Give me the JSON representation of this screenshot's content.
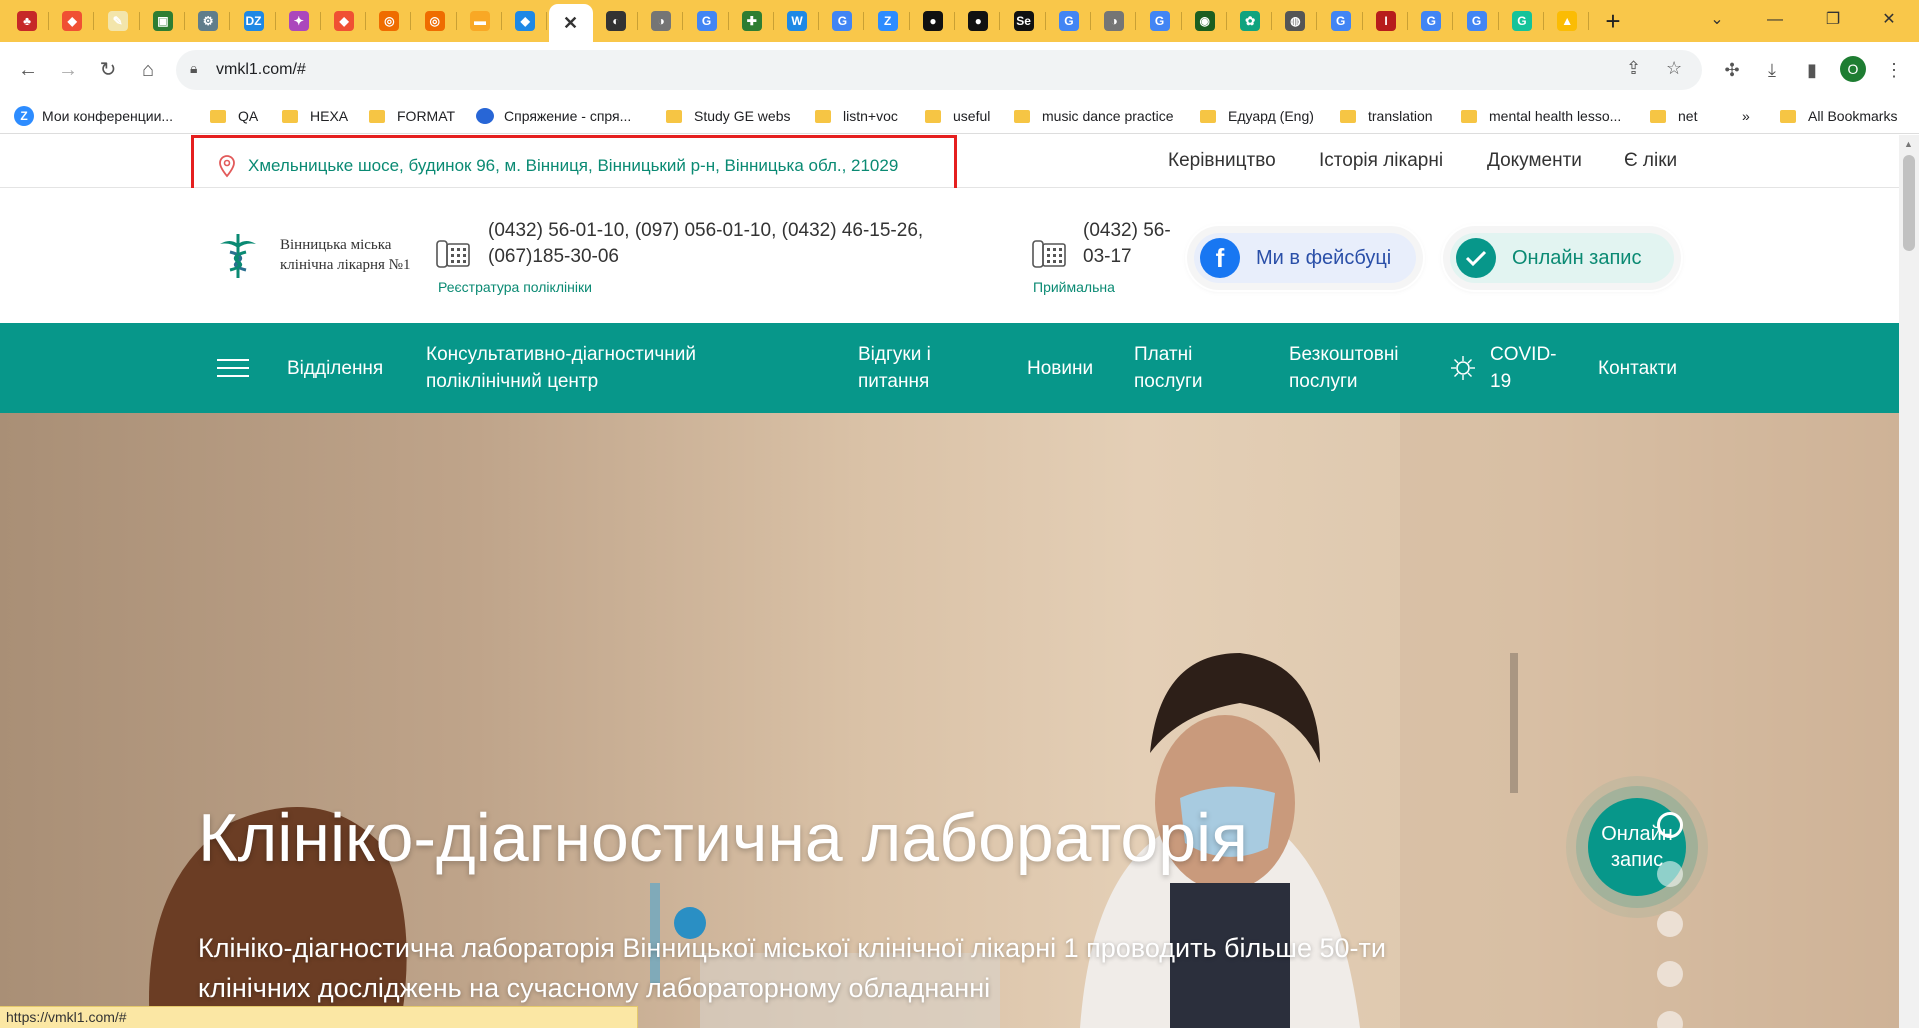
{
  "browser": {
    "url": "vmkl1.com/#",
    "status_url": "https://vmkl1.com/#",
    "profile_initial": "O",
    "new_tab_icon": "plus-icon",
    "tabs": [
      {
        "icon": "red-bug-icon",
        "color": "#c62828",
        "glyph": "♣"
      },
      {
        "icon": "git-icon",
        "color": "#f05033",
        "glyph": "◆"
      },
      {
        "icon": "notepad-icon",
        "color": "#f3e5ab",
        "glyph": "✎"
      },
      {
        "icon": "green-app-icon",
        "color": "#2e7d32",
        "glyph": "▣"
      },
      {
        "icon": "gear-icon",
        "color": "#607d8b",
        "glyph": "⚙"
      },
      {
        "icon": "dzone-icon",
        "color": "#1e88e5",
        "glyph": "DZ"
      },
      {
        "icon": "colorful-icon",
        "color": "#ab47bc",
        "glyph": "✦"
      },
      {
        "icon": "git-icon",
        "color": "#f05033",
        "glyph": "◆"
      },
      {
        "icon": "orange-ring-icon",
        "color": "#ef6c00",
        "glyph": "◎"
      },
      {
        "icon": "orange-ring-icon",
        "color": "#ef6c00",
        "glyph": "◎"
      },
      {
        "icon": "slides-icon",
        "color": "#f9a825",
        "glyph": "▬"
      },
      {
        "icon": "jira-icon",
        "color": "#1e88e5",
        "glyph": "◆"
      },
      {
        "icon": "close-icon",
        "active": true,
        "glyph": "✕"
      },
      {
        "icon": "dark-globe-icon",
        "color": "#333333",
        "glyph": "◐"
      },
      {
        "icon": "globe-icon",
        "color": "#757575",
        "glyph": "◑"
      },
      {
        "icon": "google-icon",
        "color": "#4285f4",
        "glyph": "G"
      },
      {
        "icon": "plus-green-icon",
        "color": "#2e7d32",
        "glyph": "✚"
      },
      {
        "icon": "wp-icon",
        "color": "#1e88e5",
        "glyph": "W"
      },
      {
        "icon": "google-icon",
        "color": "#4285f4",
        "glyph": "G"
      },
      {
        "icon": "zoom-icon",
        "color": "#2d8cff",
        "glyph": "Z"
      },
      {
        "icon": "github-icon",
        "color": "#111111",
        "glyph": "●"
      },
      {
        "icon": "github-icon",
        "color": "#111111",
        "glyph": "●"
      },
      {
        "icon": "se-icon",
        "color": "#111111",
        "glyph": "Se"
      },
      {
        "icon": "google-icon",
        "color": "#4285f4",
        "glyph": "G"
      },
      {
        "icon": "globe-icon",
        "color": "#757575",
        "glyph": "◑"
      },
      {
        "icon": "google-icon",
        "color": "#4285f4",
        "glyph": "G"
      },
      {
        "icon": "green-circle-icon",
        "color": "#1b5e20",
        "glyph": "◉"
      },
      {
        "icon": "openai-icon",
        "color": "#10a37f",
        "glyph": "✿"
      },
      {
        "icon": "chrome-icon",
        "color": "#555555",
        "glyph": "◍"
      },
      {
        "icon": "google-icon",
        "color": "#4285f4",
        "glyph": "G"
      },
      {
        "icon": "red-i-icon",
        "color": "#b71c1c",
        "glyph": "I"
      },
      {
        "icon": "google-icon",
        "color": "#4285f4",
        "glyph": "G"
      },
      {
        "icon": "google-icon",
        "color": "#4285f4",
        "glyph": "G"
      },
      {
        "icon": "grammarly-icon",
        "color": "#15c39a",
        "glyph": "G"
      },
      {
        "icon": "drive-icon",
        "color": "#fbbc04",
        "glyph": "▲"
      }
    ],
    "bookmarks": [
      {
        "label": "Мои конференции...",
        "type": "zoom"
      },
      {
        "label": "QA",
        "type": "folder"
      },
      {
        "label": "HEXA",
        "type": "folder"
      },
      {
        "label": "FORMAT",
        "type": "folder"
      },
      {
        "label": "Спряжение - спря...",
        "type": "bubble"
      },
      {
        "label": "Study GE webs",
        "type": "folder"
      },
      {
        "label": "listn+voc",
        "type": "folder"
      },
      {
        "label": "useful",
        "type": "folder"
      },
      {
        "label": "music dance practice",
        "type": "folder"
      },
      {
        "label": "Едуард (Eng)",
        "type": "folder"
      },
      {
        "label": "translation",
        "type": "folder"
      },
      {
        "label": "mental health lesso...",
        "type": "folder"
      },
      {
        "label": "net",
        "type": "folder"
      }
    ],
    "more_bookmarks": "»",
    "all_bookmarks": "All Bookmarks"
  },
  "site": {
    "address": "Хмельницьке шосе, будинок 96, м. Вінниця, Вінницький р-н, Вінницька обл., 21029",
    "top_links": [
      "Керівництво",
      "Історія лікарні",
      "Документи",
      "Є ліки"
    ],
    "logo_text": "Вінницька міська клінічна лікарня №1",
    "registry_phones": "(0432) 56-01-10, (097) 056-01-10, (0432) 46-15-26, (067)185-30-06",
    "registry_caption": "Реєстратура поліклініки",
    "admission_phone": "(0432) 56-03-17",
    "admission_caption": "Приймальна",
    "facebook_label": "Ми в фейсбуці",
    "online_label": "Онлайн запис",
    "nav": [
      "Відділення",
      "Консультативно-діагностичний поліклінічний центр",
      "Відгуки і питання",
      "Новини",
      "Платні послуги",
      "Безкоштовні послуги",
      "COVID-19",
      "Контакти"
    ],
    "hero_title": "Клініко-діагностична лабораторія",
    "hero_text": "Клініко-діагностична лабораторія Вінницької міської клінічної лікарні 1 проводить більше 50-ти клінічних досліджень на сучасному лабораторному обладнанні",
    "float_button": "Онлайн запис",
    "colors": {
      "brand": "#07978a",
      "address_text": "#0a8a73",
      "highlight": "#e51f1f",
      "facebook": "#1877f2"
    }
  }
}
